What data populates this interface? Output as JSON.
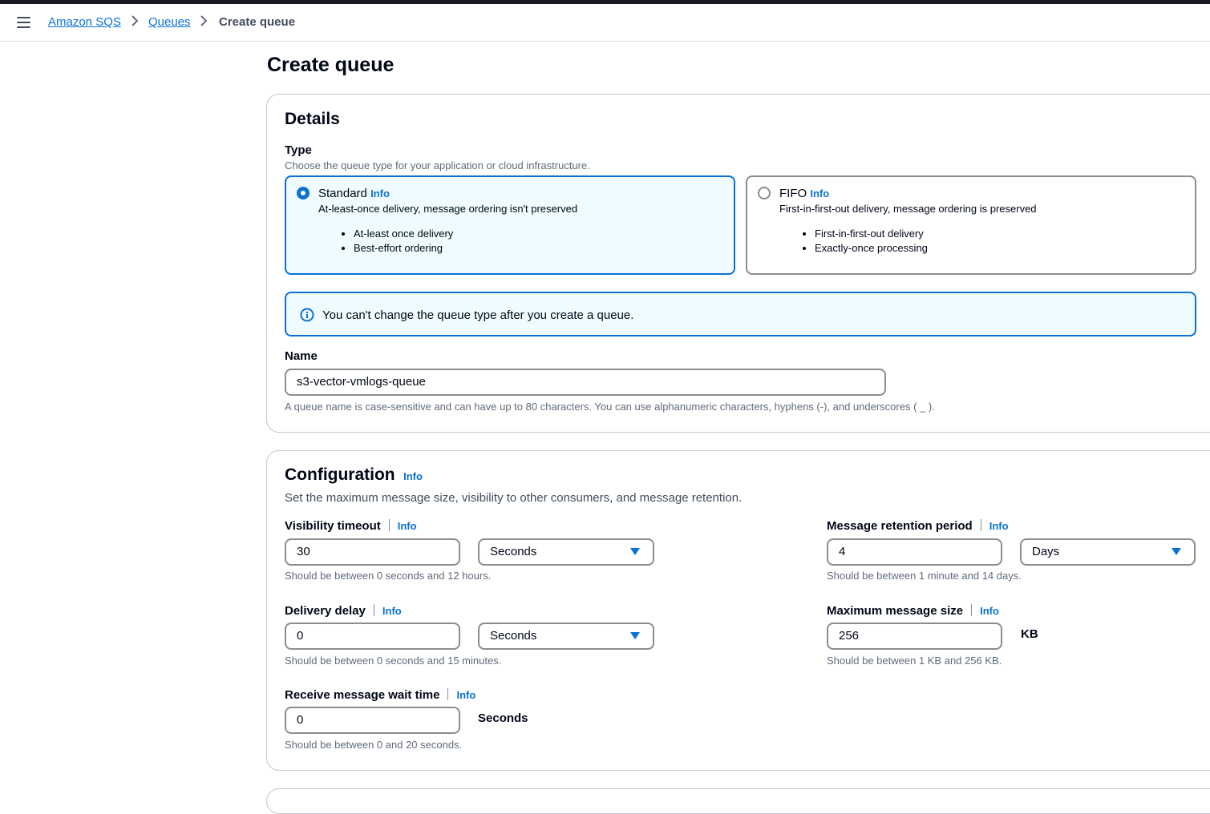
{
  "breadcrumb": {
    "items": [
      "Amazon SQS",
      "Queues",
      "Create queue"
    ]
  },
  "page": {
    "title": "Create queue"
  },
  "details": {
    "title": "Details",
    "type_label": "Type",
    "type_desc": "Choose the queue type for your application or cloud infrastructure.",
    "standard": {
      "title": "Standard",
      "info": "Info",
      "desc": "At-least-once delivery, message ordering isn't preserved",
      "bullets": [
        "At-least once delivery",
        "Best-effort ordering"
      ],
      "selected": true
    },
    "fifo": {
      "title": "FIFO",
      "info": "Info",
      "desc": "First-in-first-out delivery, message ordering is preserved",
      "bullets": [
        "First-in-first-out delivery",
        "Exactly-once processing"
      ],
      "selected": false
    },
    "alert": "You can't change the queue type after you create a queue.",
    "name_label": "Name",
    "name_value": "s3-vector-vmlogs-queue",
    "name_hint": "A queue name is case-sensitive and can have up to 80 characters. You can use alphanumeric characters, hyphens (-), and underscores ( _ )."
  },
  "configuration": {
    "title": "Configuration",
    "info": "Info",
    "desc": "Set the maximum message size, visibility to other consumers, and message retention.",
    "visibility_timeout": {
      "label": "Visibility timeout",
      "info": "Info",
      "value": "30",
      "unit": "Seconds",
      "hint": "Should be between 0 seconds and 12 hours."
    },
    "delivery_delay": {
      "label": "Delivery delay",
      "info": "Info",
      "value": "0",
      "unit": "Seconds",
      "hint": "Should be between 0 seconds and 15 minutes."
    },
    "receive_wait": {
      "label": "Receive message wait time",
      "info": "Info",
      "value": "0",
      "unit": "Seconds",
      "hint": "Should be between 0 and 20 seconds."
    },
    "retention": {
      "label": "Message retention period",
      "info": "Info",
      "value": "4",
      "unit": "Days",
      "hint": "Should be between 1 minute and 14 days."
    },
    "max_size": {
      "label": "Maximum message size",
      "info": "Info",
      "value": "256",
      "unit": "KB",
      "hint": "Should be between 1 KB and 256 KB."
    }
  },
  "colors": {
    "accent": "#0972d3",
    "text": "#000716",
    "muted": "#5f6b7a",
    "selected_bg": "#f0fbff"
  },
  "icons": {
    "menu": "hamburger-menu-icon",
    "separator": "chevron-right-icon",
    "alert": "info-circle-icon",
    "dropdown": "caret-down-icon"
  }
}
